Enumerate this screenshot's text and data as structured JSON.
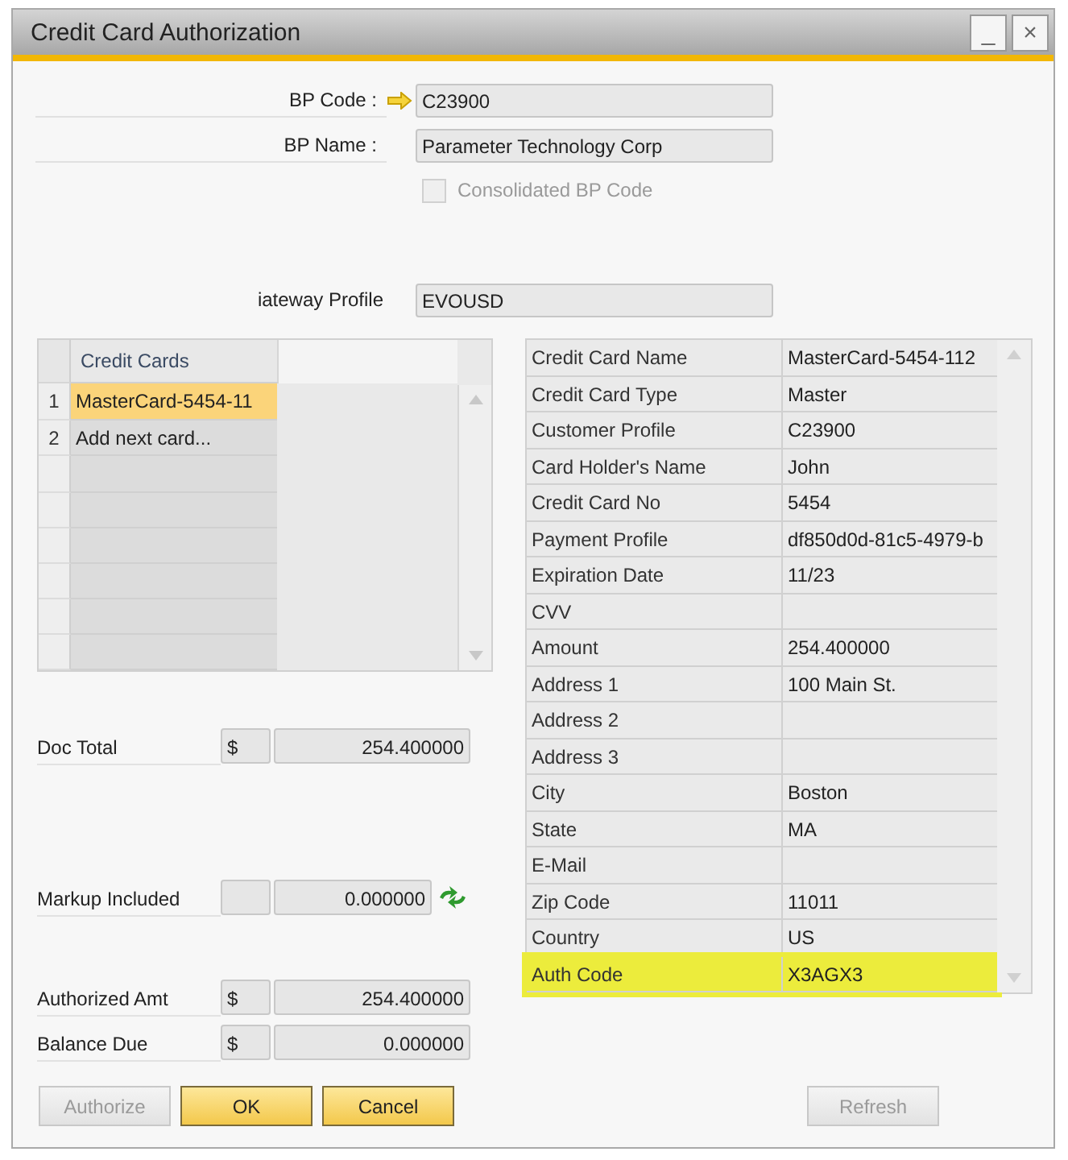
{
  "window": {
    "title": "Credit Card Authorization",
    "controls": [
      "_",
      "×"
    ]
  },
  "header_fields": [
    {
      "label": "BP Code :",
      "value": "C23900",
      "kind": "linked"
    },
    {
      "label": "BP Name :",
      "value": "Parameter Technology Corp",
      "kind": "plain"
    }
  ],
  "consolidated": {
    "label": "Consolidated BP Code",
    "checked": false,
    "disabled": true
  },
  "gateway": {
    "label": "iateway Profile",
    "value": "EVOUSD"
  },
  "cards_table": {
    "columns": [
      "Credit Cards"
    ],
    "rows": [
      {
        "number": "1",
        "name": "MasterCard-5454-11",
        "selected": true
      },
      {
        "number": "2",
        "name": "Add next card...",
        "selected": false
      }
    ]
  },
  "properties": [
    {
      "label": "Credit Card Name",
      "value": "MasterCard-5454-112",
      "highlighted": false
    },
    {
      "label": "Credit Card Type",
      "value": "Master",
      "highlighted": false
    },
    {
      "label": "Customer Profile",
      "value": "C23900",
      "highlighted": false
    },
    {
      "label": "Card Holder's Name",
      "value": "John",
      "highlighted": false
    },
    {
      "label": "Credit Card No",
      "value": "5454",
      "highlighted": false
    },
    {
      "label": "Payment Profile",
      "value": "df850d0d-81c5-4979-b",
      "highlighted": false
    },
    {
      "label": "Expiration Date",
      "value": "11/23",
      "highlighted": false
    },
    {
      "label": "CVV",
      "highlighted": false
    },
    {
      "label": "Amount",
      "value": "254.400000",
      "highlighted": false
    },
    {
      "label": "Address 1",
      "value": "100 Main St.",
      "highlighted": false
    },
    {
      "label": "Address 2",
      "highlighted": false
    },
    {
      "label": "Address 3",
      "highlighted": false
    },
    {
      "label": "City",
      "value": "Boston",
      "highlighted": false
    },
    {
      "label": "State",
      "value": "MA",
      "highlighted": false
    },
    {
      "label": "E-Mail",
      "highlighted": false
    },
    {
      "label": "Zip Code",
      "value": "11011",
      "highlighted": false
    },
    {
      "label": "Country",
      "value": "US",
      "highlighted": false
    },
    {
      "label": "Auth Code",
      "value": "X3AGX3",
      "highlighted": true
    }
  ],
  "amounts": [
    {
      "label": "Doc Total",
      "currency": "$",
      "value": "254.400000",
      "kind": "plain"
    },
    {
      "label": "Markup Included",
      "value": "0.000000",
      "kind": "with_refresh"
    },
    {
      "label": "Authorized Amt",
      "currency": "$",
      "value": "254.400000",
      "kind": "plain"
    },
    {
      "label": "Balance Due",
      "currency": "$",
      "value": "0.000000",
      "kind": "plain"
    }
  ],
  "buttons": [
    {
      "label": "Authorize",
      "kind": "plain",
      "disabled": true
    },
    {
      "label": "OK",
      "kind": "primary",
      "disabled": false
    },
    {
      "label": "Cancel",
      "kind": "primary",
      "disabled": false
    },
    {
      "label": "Refresh",
      "kind": "plain",
      "disabled": true
    }
  ]
}
